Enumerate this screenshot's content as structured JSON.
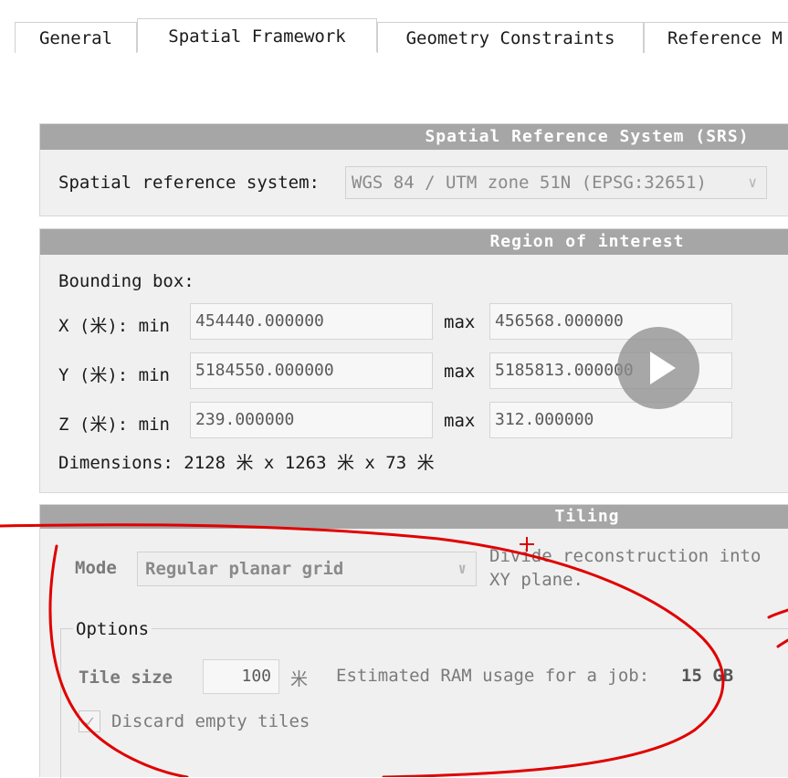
{
  "tabs": [
    {
      "label": "General"
    },
    {
      "label": "Spatial Framework",
      "active": true
    },
    {
      "label": "Geometry Constraints"
    },
    {
      "label": "Reference M"
    }
  ],
  "srs": {
    "header": "Spatial Reference System (SRS)",
    "label": "Spatial reference system:",
    "value": "WGS 84 / UTM zone 51N (EPSG:32651)"
  },
  "roi": {
    "header": "Region of interest",
    "bbox_label": "Bounding box:",
    "rows": [
      {
        "axis": "X (米): min",
        "min": "454440.000000",
        "max_label": "max",
        "max": "456568.000000"
      },
      {
        "axis": "Y (米): min",
        "min": "5184550.000000",
        "max_label": "max",
        "max": "5185813.000000"
      },
      {
        "axis": "Z (米): min",
        "min": "239.000000",
        "max_label": "max",
        "max": "312.000000"
      }
    ],
    "dimensions": "Dimensions: 2128 米 x 1263 米 x 73 米"
  },
  "tiling": {
    "header": "Tiling",
    "mode_label": "Mode",
    "mode_value": "Regular planar grid",
    "description_line1": "Divide reconstruction into",
    "description_line2": "XY plane.",
    "options_label": "Options",
    "tile_size_label": "Tile size",
    "tile_size_value": "100",
    "tile_size_unit": "米",
    "ram_label": "Estimated RAM usage for a job:",
    "ram_value": "15 GB",
    "discard_label": "Discard empty tiles",
    "discard_checked": true
  },
  "icons": {
    "combo_arrow": "chevron-down-icon",
    "video": "play-icon",
    "check": "check-icon"
  },
  "colors": {
    "header_bg": "#a6a6a6",
    "panel_bg": "#f0f0f0",
    "annotation": "#e00000"
  }
}
